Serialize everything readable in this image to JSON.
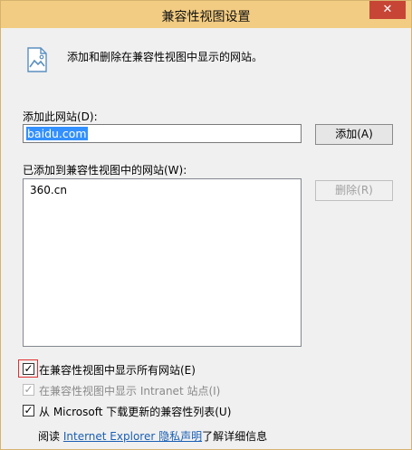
{
  "window": {
    "title": "兼容性视图设置",
    "close_icon": "close-icon",
    "close_glyph": "✕",
    "accent": "#f2cc82",
    "close_color": "#c74535"
  },
  "header": {
    "icon": "webpage-icon",
    "description": "添加和删除在兼容性视图中显示的网站。"
  },
  "add_section": {
    "label": "添加此网站(D):",
    "input_value": "baidu.com",
    "add_button": "添加(A)"
  },
  "list_section": {
    "label": "已添加到兼容性视图中的网站(W):",
    "items": [
      "360.cn"
    ],
    "remove_button": "删除(R)"
  },
  "options": [
    {
      "label": "在兼容性视图中显示所有网站(E)",
      "checked": true,
      "enabled": true,
      "check_glyph": "✓"
    },
    {
      "label": "在兼容性视图中显示 Intranet 站点(I)",
      "checked": true,
      "enabled": false,
      "check_glyph": "✓"
    },
    {
      "label": "从 Microsoft 下载更新的兼容性列表(U)",
      "checked": true,
      "enabled": true,
      "check_glyph": "✓"
    }
  ],
  "footer": {
    "prefix": "阅读",
    "link": "Internet Explorer 隐私声明",
    "suffix": "了解详细信息"
  }
}
